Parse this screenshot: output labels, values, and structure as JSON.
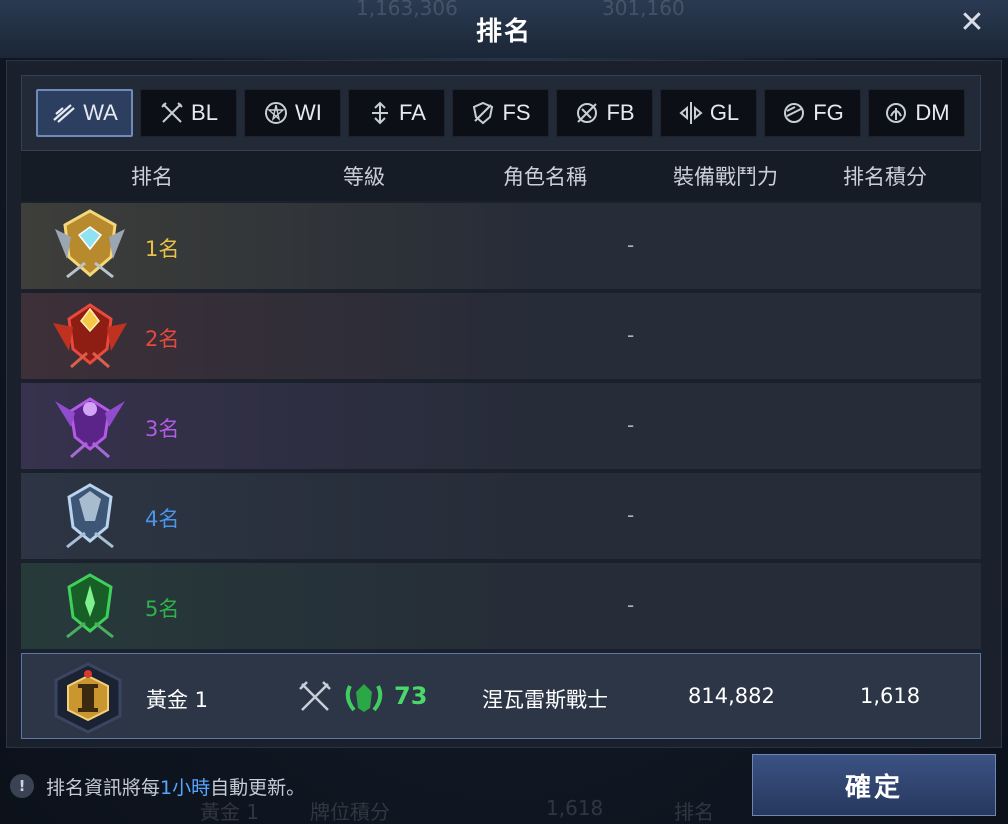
{
  "header": {
    "title": "排名",
    "close_label": "✕"
  },
  "background_text": {
    "top_left_value": "1,163,306",
    "top_right_value": "301,160",
    "bottom_tier": "黃金 1",
    "bottom_score_label": "牌位積分",
    "bottom_score": "1,618",
    "bottom_rank_label": "排名",
    "mid_power": "814,882"
  },
  "tabs": [
    {
      "label": "WA",
      "icon": "warrior-icon",
      "active": true
    },
    {
      "label": "BL",
      "icon": "blade-icon",
      "active": false
    },
    {
      "label": "WI",
      "icon": "wizard-icon",
      "active": false
    },
    {
      "label": "FA",
      "icon": "force-archer-icon",
      "active": false
    },
    {
      "label": "FS",
      "icon": "force-shielder-icon",
      "active": false
    },
    {
      "label": "FB",
      "icon": "force-blader-icon",
      "active": false
    },
    {
      "label": "GL",
      "icon": "gladiator-icon",
      "active": false
    },
    {
      "label": "FG",
      "icon": "force-gunner-icon",
      "active": false
    },
    {
      "label": "DM",
      "icon": "dark-mage-icon",
      "active": false
    }
  ],
  "table": {
    "headers": {
      "rank": "排名",
      "level": "等級",
      "name": "角色名稱",
      "power": "裝備戰鬥力",
      "score": "排名積分"
    },
    "rows": [
      {
        "rank": "1名",
        "value": "-",
        "color": "#e9c347",
        "medal": "gold-medal-icon"
      },
      {
        "rank": "2名",
        "value": "-",
        "color": "#e8493c",
        "medal": "red-medal-icon"
      },
      {
        "rank": "3名",
        "value": "-",
        "color": "#b45ae6",
        "medal": "purple-medal-icon"
      },
      {
        "rank": "4名",
        "value": "-",
        "color": "#4b94e8",
        "medal": "silver-medal-icon"
      },
      {
        "rank": "5名",
        "value": "-",
        "color": "#2fb24a",
        "medal": "green-medal-icon"
      }
    ]
  },
  "player": {
    "tier": "黃金 1",
    "emblem": "gold-tier-emblem-icon",
    "class_icon": "crossed-swords-icon",
    "level": "73",
    "name": "涅瓦雷斯戰士",
    "power": "814,882",
    "score": "1,618"
  },
  "footer": {
    "info_icon": "!",
    "note_prefix": "排名資訊將每",
    "note_highlight": "1小時",
    "note_suffix": "自動更新。",
    "confirm_label": "確定"
  },
  "colors": {
    "active_tab_border": "#6f8bb8",
    "level_green": "#4bd86a",
    "highlight_blue": "#58a6ff"
  }
}
